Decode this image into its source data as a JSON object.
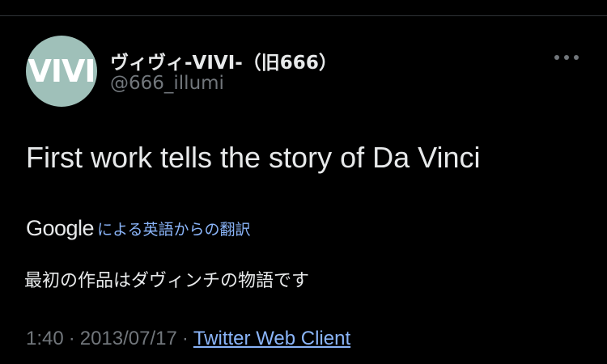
{
  "author": {
    "avatar_text": "VIVI",
    "avatar_color": "#9fc0b9",
    "display_name": "ヴィヴィ-VIVI-（旧666）",
    "handle": "@666_illumi"
  },
  "more_icon": "more-horizontal-icon",
  "tweet": {
    "text": "First work tells the story of Da Vinci"
  },
  "translation": {
    "provider": "Google",
    "label": "による英語からの翻訳",
    "text": "最初の作品はダヴィンチの物語です"
  },
  "meta": {
    "time": "1:40",
    "separator": "·",
    "date": "2013/07/17",
    "source": "Twitter Web Client"
  },
  "colors": {
    "background": "#000000",
    "primary_text": "#e7e9ea",
    "secondary_text": "#71767b",
    "link": "#8ab4f8",
    "divider": "#2f3336"
  }
}
